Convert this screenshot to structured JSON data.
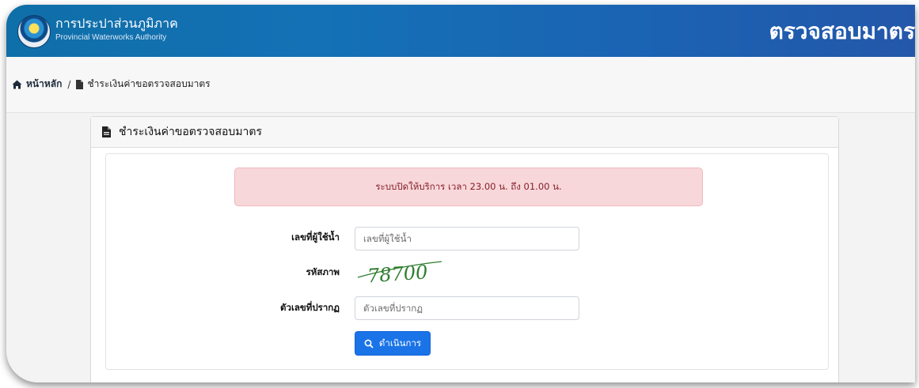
{
  "header": {
    "org_name_th": "การประปาส่วนภูมิภาค",
    "org_name_en": "Provincial Waterworks Authority",
    "page_heading": "ตรวจสอบมาตร"
  },
  "breadcrumb": {
    "home_label": "หน้าหลัก",
    "separator": "/",
    "current_label": "ชำระเงินค่าขอตรวจสอบมาตร"
  },
  "card": {
    "title": "ชำระเงินค่าขอตรวจสอบมาตร"
  },
  "alert": {
    "message": "ระบบปิดให้บริการ เวลา 23.00 น. ถึง 01.00 น."
  },
  "form": {
    "user_number_label": "เลขที่ผู้ใช้น้ำ",
    "user_number_placeholder": "เลขที่ผู้ใช้น้ำ",
    "captcha_label": "รหัสภาพ",
    "captcha_text": "78700",
    "captcha_input_label": "ตัวเลขที่ปรากฏ",
    "captcha_input_placeholder": "ตัวเลขที่ปรากฏ",
    "submit_label": "ดำเนินการ"
  },
  "icons": {
    "home": "home-icon",
    "document": "file-icon",
    "search": "search-icon"
  },
  "colors": {
    "header_blue": "#1471b6",
    "alert_bg": "#f8d7da",
    "alert_text": "#842029",
    "primary_button": "#1a74e8",
    "captcha_green": "#2f7d2f"
  }
}
